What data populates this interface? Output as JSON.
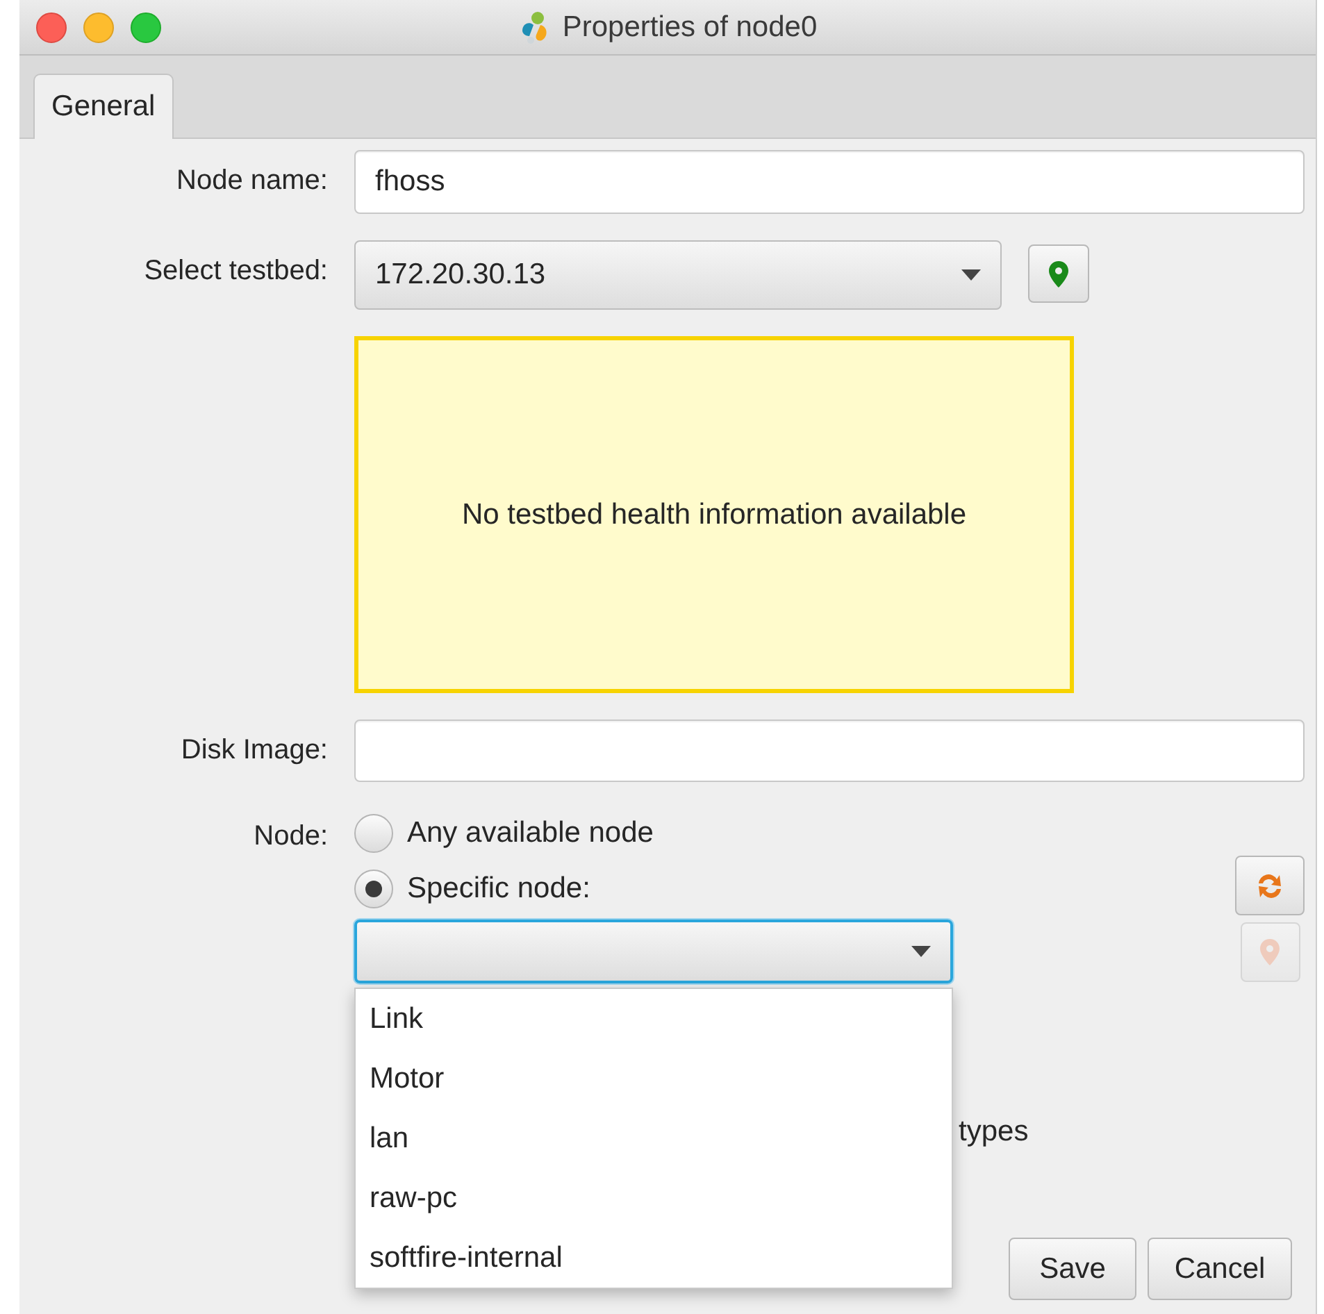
{
  "window": {
    "title": "Properties of node0"
  },
  "tabs": [
    {
      "label": "General",
      "selected": true
    }
  ],
  "form": {
    "node_name": {
      "label": "Node name:",
      "value": "fhoss"
    },
    "testbed": {
      "label": "Select testbed:",
      "value": "172.20.30.13"
    },
    "health_message": "No testbed health information available",
    "disk_image": {
      "label": "Disk Image:"
    },
    "node": {
      "label": "Node:",
      "options": [
        {
          "label": "Any available node",
          "selected": false
        },
        {
          "label": "Specific node:",
          "selected": true
        }
      ]
    },
    "node_dropdown": {
      "focused": true,
      "open": true,
      "items": [
        "Link",
        "Motor",
        "lan",
        "raw-pc",
        "softfire-internal"
      ]
    },
    "node_locate_button": {
      "disabled": true
    },
    "partly_hidden_text": "types"
  },
  "buttons": [
    "Save",
    "Cancel"
  ]
}
